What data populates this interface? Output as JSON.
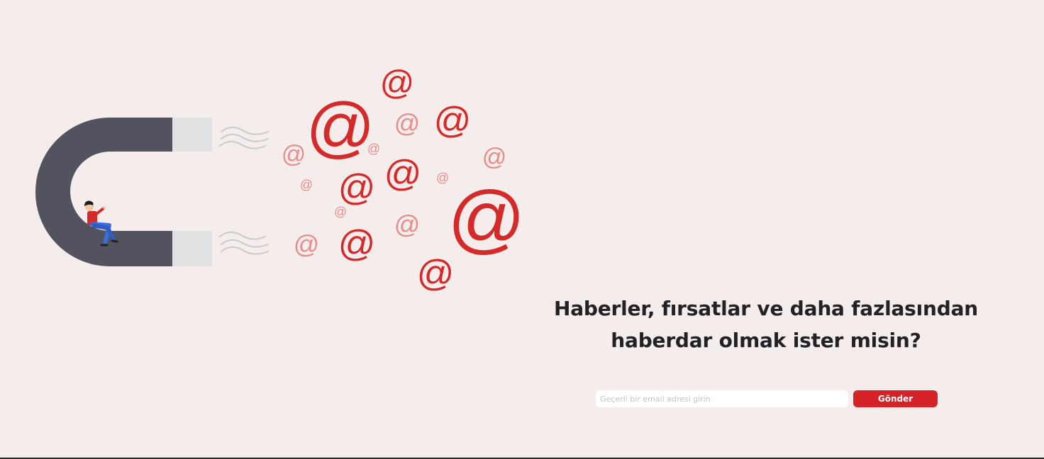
{
  "newsletter": {
    "headline_line1": "Haberler, fırsatlar ve daha fazlasından",
    "headline_line2": "haberdar olmak ister misin?",
    "email_placeholder": "Geçerli bir email adresi girin",
    "email_value": "",
    "submit_label": "Gönder"
  },
  "illustration": {
    "symbol": "@",
    "magnet_icon": "magnet-icon",
    "person_icon": "person-icon",
    "colors": {
      "accent": "#d42a2a",
      "accent_light": "#e88d8d",
      "magnet_body": "#53535f",
      "magnet_tip": "#e1e1e1",
      "background": "#f5ecec",
      "button": "#d42226"
    }
  }
}
